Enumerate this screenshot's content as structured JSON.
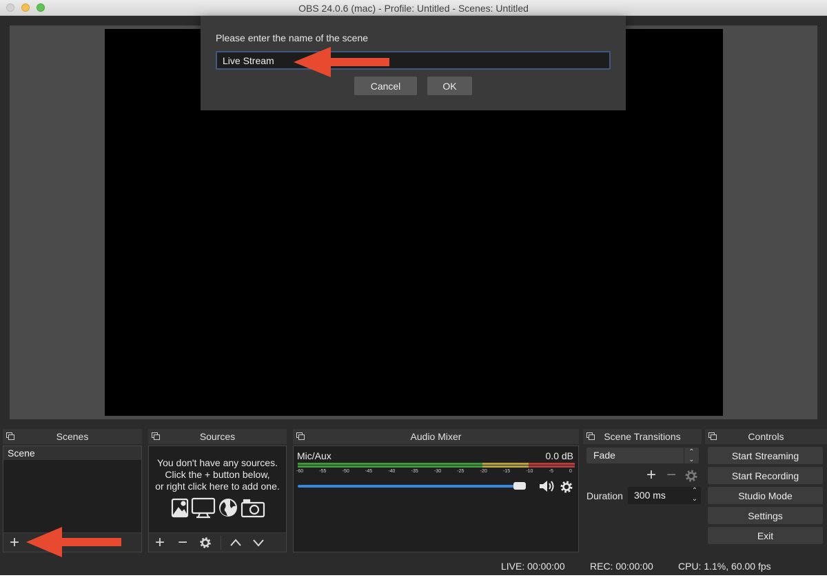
{
  "window": {
    "title": "OBS 24.0.6 (mac) - Profile: Untitled - Scenes: Untitled"
  },
  "dialog": {
    "prompt": "Please enter the name of the scene",
    "input_value": "Live Stream",
    "cancel_label": "Cancel",
    "ok_label": "OK"
  },
  "docks": {
    "scenes": {
      "title": "Scenes",
      "items": [
        "Scene"
      ],
      "toolbar": [
        "+"
      ]
    },
    "sources": {
      "title": "Sources",
      "empty_lines": [
        "You don't have any sources.",
        "Click the + button below,",
        "or right click here to add one."
      ],
      "toolbar": [
        "+",
        "−",
        "gear-icon",
        "chevron-up-icon",
        "chevron-down-icon"
      ]
    },
    "audio_mixer": {
      "title": "Audio Mixer",
      "channel": "Mic/Aux",
      "db": "0.0 dB",
      "ticks": [
        "-60",
        "-55",
        "-50",
        "-45",
        "-40",
        "-35",
        "-30",
        "-25",
        "-20",
        "-15",
        "-10",
        "-5",
        "0"
      ],
      "volume_level": 0.95
    },
    "transitions": {
      "title": "Scene Transitions",
      "selected": "Fade",
      "duration_label": "Duration",
      "duration_value": "300 ms"
    },
    "controls": {
      "title": "Controls",
      "buttons": [
        "Start Streaming",
        "Start Recording",
        "Studio Mode",
        "Settings",
        "Exit"
      ]
    }
  },
  "status": {
    "live": "LIVE: 00:00:00",
    "rec": "REC: 00:00:00",
    "cpu": "CPU: 1.1%, 60.00 fps"
  },
  "colors": {
    "accent": "#3a85dc",
    "annotation_arrow": "#e84a2f",
    "meter_green": "#3f9b3a",
    "meter_yellow": "#b8a23a",
    "meter_red": "#b83a3a"
  }
}
